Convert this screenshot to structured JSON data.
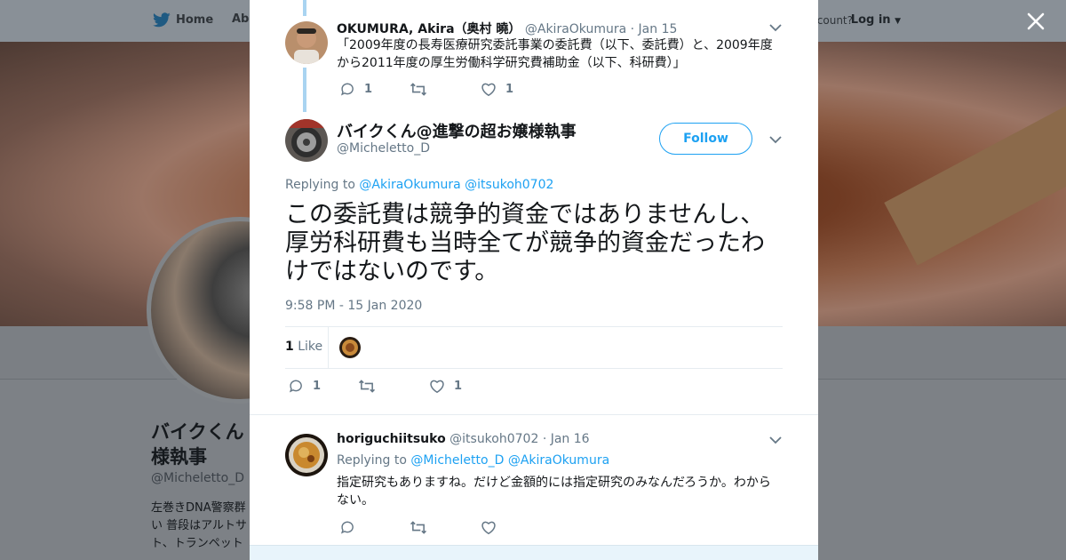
{
  "background": {
    "nav_home": "Home",
    "nav_about": "Abo",
    "account_prompt": "ccount?",
    "login": "Log in",
    "profile_name": "バイクくん 様執事",
    "profile_handle": "@Micheletto_D",
    "profile_bio": "左巻きDNA警察群 い 普段はアルトサ ト、トランペット"
  },
  "parent_tweet": {
    "name": "OKUMURA, Akira（奥村 曉）",
    "handle": "@AkiraOkumura",
    "date": "· Jan 15",
    "text": "「2009年度の長寿医療研究委託事業の委託費（以下、委託費）と、2009年度から2011年度の厚生労働科学研究費補助金（以下、科研費）」",
    "reply_count": "1",
    "retweet_count": "",
    "like_count": "1"
  },
  "main_tweet": {
    "name": "バイクくん@進撃の超お嬢様執事",
    "handle": "@Micheletto_D",
    "follow_label": "Follow",
    "replying_prefix": "Replying to",
    "replying_to_1": "@AkiraOkumura",
    "replying_to_2": "@itsukoh0702",
    "text": "この委託費は競争的資金ではありませんし、厚労科研費も当時全てが競争的資金だったわけではないのです。",
    "timestamp": "9:58 PM - 15 Jan 2020",
    "likes_count": "1",
    "likes_label": "Like",
    "reply_count": "1",
    "retweet_count": "",
    "like_count": "1"
  },
  "reply_tweet": {
    "name": "horiguchiitsuko",
    "handle": "@itsukoh0702",
    "date": "· Jan 16",
    "replying_prefix": "Replying to",
    "replying_to_1": "@Micheletto_D",
    "replying_to_2": "@AkiraOkumura",
    "text": "指定研究もありますね。だけど金額的には指定研究のみなんだろうか。わからない。",
    "reply_count": "",
    "retweet_count": "",
    "like_count": ""
  },
  "colors": {
    "accent": "#1da1f2",
    "text": "#14171a",
    "secondary": "#657786",
    "thread_line": "#a9d4f1"
  },
  "icons": [
    "twitter-bird-icon",
    "close-icon",
    "chevron-down-icon",
    "reply-icon",
    "retweet-icon",
    "heart-icon"
  ]
}
